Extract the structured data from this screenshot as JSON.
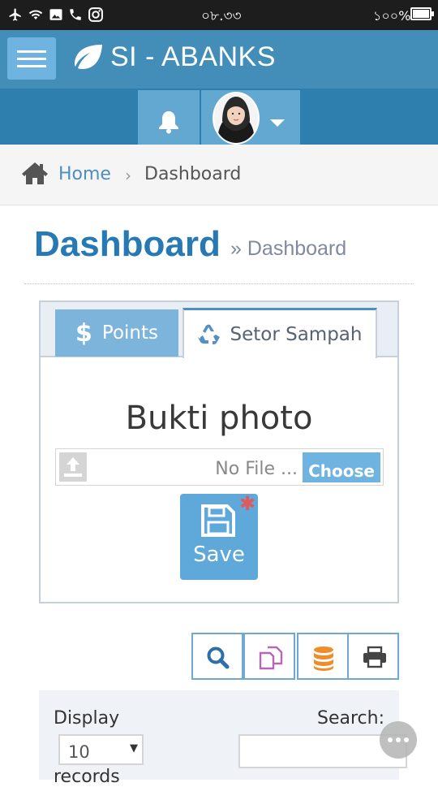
{
  "status_bar": {
    "time": "০৮.৩৩",
    "battery": "১০০%"
  },
  "app": {
    "brand": "SI - ABANKS"
  },
  "breadcrumb": {
    "home": "Home",
    "current": "Dashboard"
  },
  "page_header": {
    "title": "Dashboard",
    "subtitle": "Dashboard"
  },
  "tabs": [
    {
      "label": "Points",
      "icon": "dollar-icon",
      "active": false
    },
    {
      "label": "Setor Sampah",
      "icon": "recycle-icon",
      "active": true
    }
  ],
  "form": {
    "field_label": "Bukti photo",
    "file_placeholder": "No File ...",
    "choose_label": "Choose",
    "save_label": "Save"
  },
  "toolbar": [
    "search-icon",
    "copy-icon",
    "database-icon",
    "print-icon"
  ],
  "table_controls": {
    "display_label": "Display",
    "page_size": "10",
    "records_label": "records",
    "search_label": "Search:"
  },
  "colors": {
    "primary": "#438eb9",
    "secondary": "#2e7fad",
    "accent": "#6fb3e0",
    "title": "#2679b5"
  }
}
